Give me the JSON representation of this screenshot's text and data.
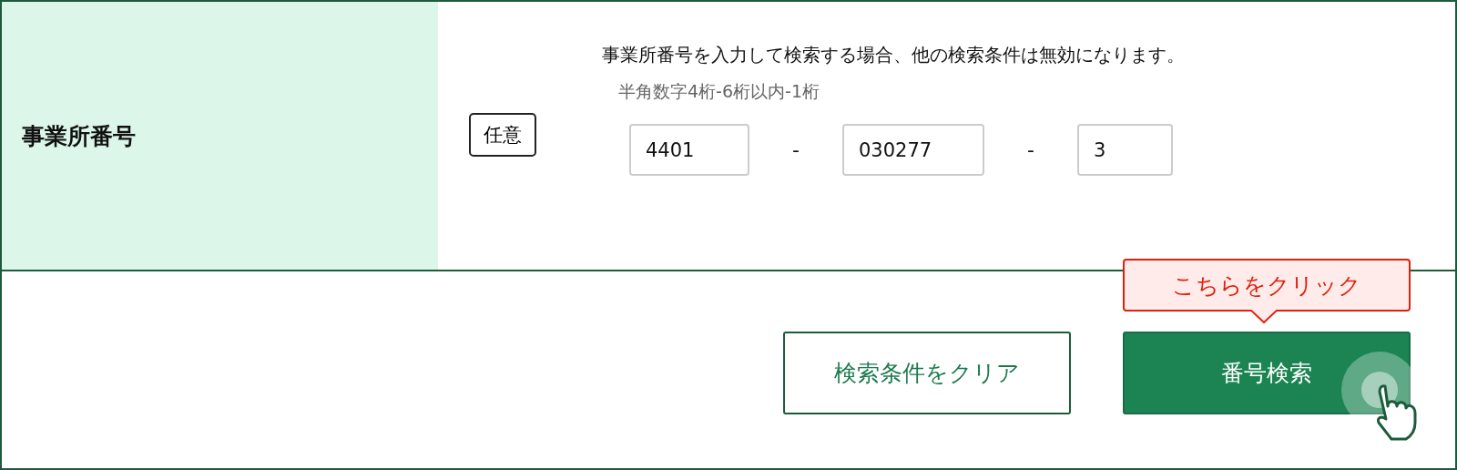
{
  "field": {
    "label": "事業所番号",
    "badge": "任意",
    "note": "事業所番号を入力して検索する場合、他の検索条件は無効になります。",
    "hint": "半角数字4桁-6桁以内-1桁",
    "inputs": [
      {
        "value": "4401"
      },
      {
        "value": "030277"
      },
      {
        "value": "3"
      }
    ],
    "separators": [
      "-",
      "-"
    ]
  },
  "buttons": [
    {
      "kind": "secondary",
      "label": "検索条件をクリア"
    },
    {
      "kind": "primary",
      "label": "番号検索",
      "tooltip": "こちらをクリック"
    }
  ]
}
